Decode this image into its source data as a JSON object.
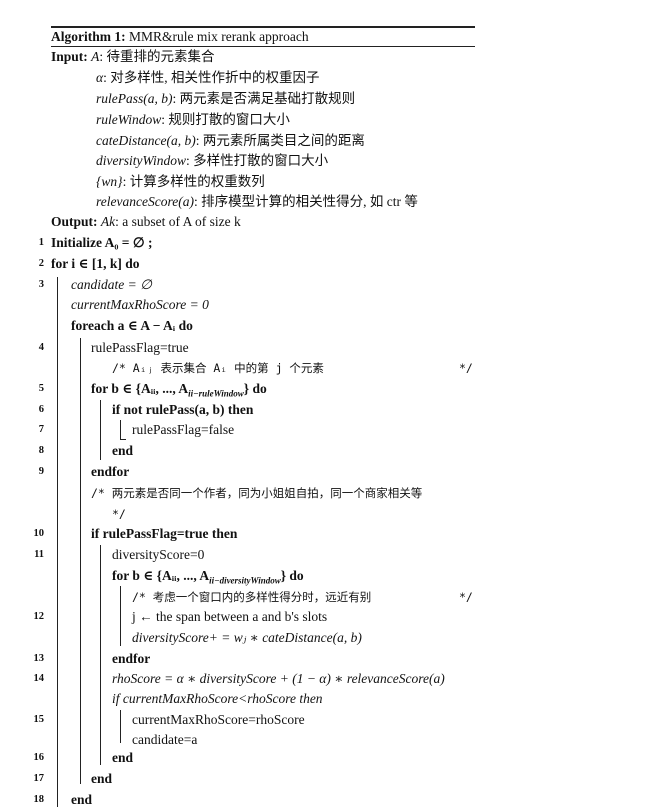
{
  "algorithm": {
    "label": "Algorithm 1:",
    "title": "MMR&rule mix rerank approach",
    "input_label": "Input:",
    "inputs": [
      {
        "name": "A",
        "desc": ": 待重排的元素集合"
      },
      {
        "name": "α",
        "desc": ": 对多样性, 相关性作折中的权重因子"
      },
      {
        "name": "rulePass(a, b)",
        "desc": ": 两元素是否满足基础打散规则"
      },
      {
        "name": "ruleWindow",
        "desc": ": 规则打散的窗口大小"
      },
      {
        "name": "cateDistance(a, b)",
        "desc": ": 两元素所属类目之间的距离"
      },
      {
        "name": "diversityWindow",
        "desc": ": 多样性打散的窗口大小"
      },
      {
        "name": "{wn}",
        "desc": ": 计算多样性的权重数列"
      },
      {
        "name": "relevanceScore(a)",
        "desc": ": 排序模型计算的相关性得分, 如 ctr 等"
      }
    ],
    "output_label": "Output:",
    "output": {
      "name": "Ak",
      "desc": ": a subset of A of size k"
    },
    "lines": [
      {
        "num": "1",
        "text": "Initialize A₀ = ∅ ;"
      },
      {
        "num": "2",
        "text": "for i ∈ [1, k] do"
      },
      {
        "num": "3",
        "text": "candidate = ∅"
      },
      {
        "num": "",
        "text": "currentMaxRhoScore = 0"
      },
      {
        "num": "",
        "text": "foreach a ∈ A − Aᵢ do"
      },
      {
        "num": "4",
        "text": "rulePassFlag=true"
      },
      {
        "num": "",
        "text": "/* Aᵢⱼ 表示集合 Aᵢ 中的第 j 个元素",
        "end": "*/"
      },
      {
        "num": "5",
        "text": "for b ∈ {Aᵢᵢ, ..., A",
        "sub": "ii−ruleWindow",
        "tail": "} do"
      },
      {
        "num": "6",
        "text": "if not rulePass(a, b) then"
      },
      {
        "num": "7",
        "text": "rulePassFlag=false"
      },
      {
        "num": "8",
        "text": "end"
      },
      {
        "num": "9",
        "text": "endfor"
      },
      {
        "num": "",
        "text": "/* 两元素是否同一个作者，同为小姐姐自拍，同一个商家相关等"
      },
      {
        "num": "",
        "text": "*/"
      },
      {
        "num": "10",
        "text": "if rulePassFlag=true then"
      },
      {
        "num": "11",
        "text": "diversityScore=0"
      },
      {
        "num": "",
        "text": "for b ∈ {Aᵢᵢ, ..., A",
        "sub": "ii−diversityWindow",
        "tail": "} do"
      },
      {
        "num": "",
        "text": "/* 考虑一个窗口内的多样性得分时，远近有别",
        "end": "*/"
      },
      {
        "num": "12",
        "text": "j ← the span between a and b's slots"
      },
      {
        "num": "",
        "text": "diversityScore+ = wⱼ ∗ cateDistance(a, b)"
      },
      {
        "num": "13",
        "text": "endfor"
      },
      {
        "num": "14",
        "text": "rhoScore = α ∗ diversityScore + (1 − α) ∗ relevanceScore(a)"
      },
      {
        "num": "",
        "text": "if currentMaxRhoScore<rhoScore then"
      },
      {
        "num": "15",
        "text": "currentMaxRhoScore=rhoScore"
      },
      {
        "num": "",
        "text": "candidate=a"
      },
      {
        "num": "16",
        "text": "end"
      },
      {
        "num": "17",
        "text": "end"
      },
      {
        "num": "18",
        "text": "end"
      }
    ]
  }
}
